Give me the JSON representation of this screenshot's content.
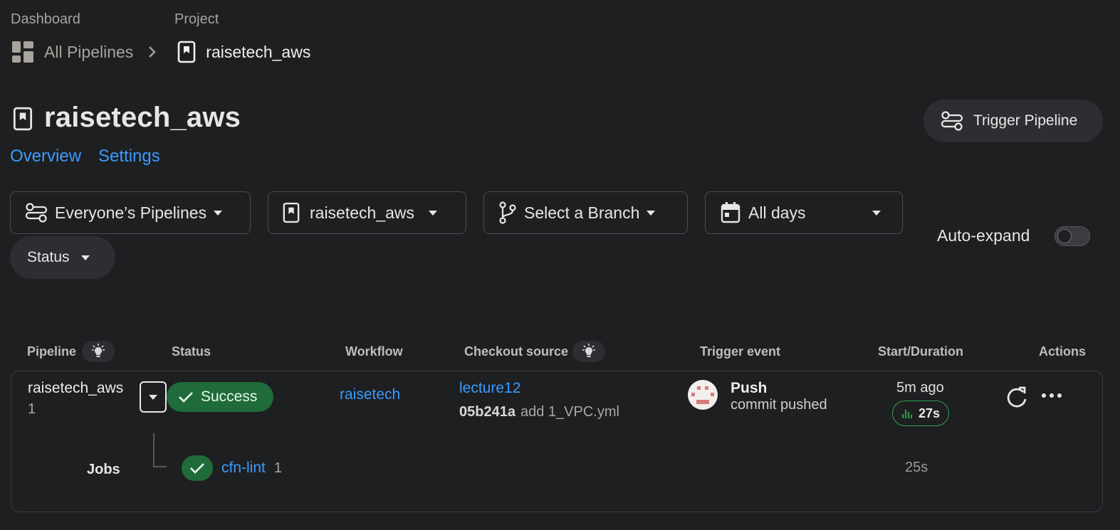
{
  "breadcrumb": {
    "dashboard_label": "Dashboard",
    "project_label": "Project",
    "all_pipelines": "All Pipelines",
    "project_name": "raisetech_aws"
  },
  "header": {
    "title": "raisetech_aws",
    "trigger_button": "Trigger Pipeline",
    "tabs": [
      {
        "label": "Overview"
      },
      {
        "label": "Settings"
      }
    ]
  },
  "filters": {
    "pipelines": "Everyone’s Pipelines",
    "project": "raisetech_aws",
    "branch": "Select a Branch",
    "days": "All days",
    "status": "Status",
    "auto_expand_label": "Auto-expand",
    "auto_expand_on": false
  },
  "table": {
    "columns": {
      "pipeline": "Pipeline",
      "status": "Status",
      "workflow": "Workflow",
      "checkout": "Checkout source",
      "trigger": "Trigger event",
      "start": "Start/Duration",
      "actions": "Actions"
    },
    "row": {
      "pipeline_name": "raisetech_aws",
      "pipeline_number": "1",
      "status": "Success",
      "workflow": "raisetech",
      "branch": "lecture12",
      "commit_sha": "05b241a",
      "commit_message": "add 1_VPC.yml",
      "trigger_event": "Push",
      "trigger_detail": "commit pushed",
      "started": "5m ago",
      "duration": "27s",
      "jobs_label": "Jobs",
      "job": {
        "name": "cfn-lint",
        "number": "1",
        "duration": "25s"
      }
    }
  },
  "colors": {
    "accent": "#3b9bff",
    "success": "#1f6b3a",
    "background": "#1e1f21"
  }
}
